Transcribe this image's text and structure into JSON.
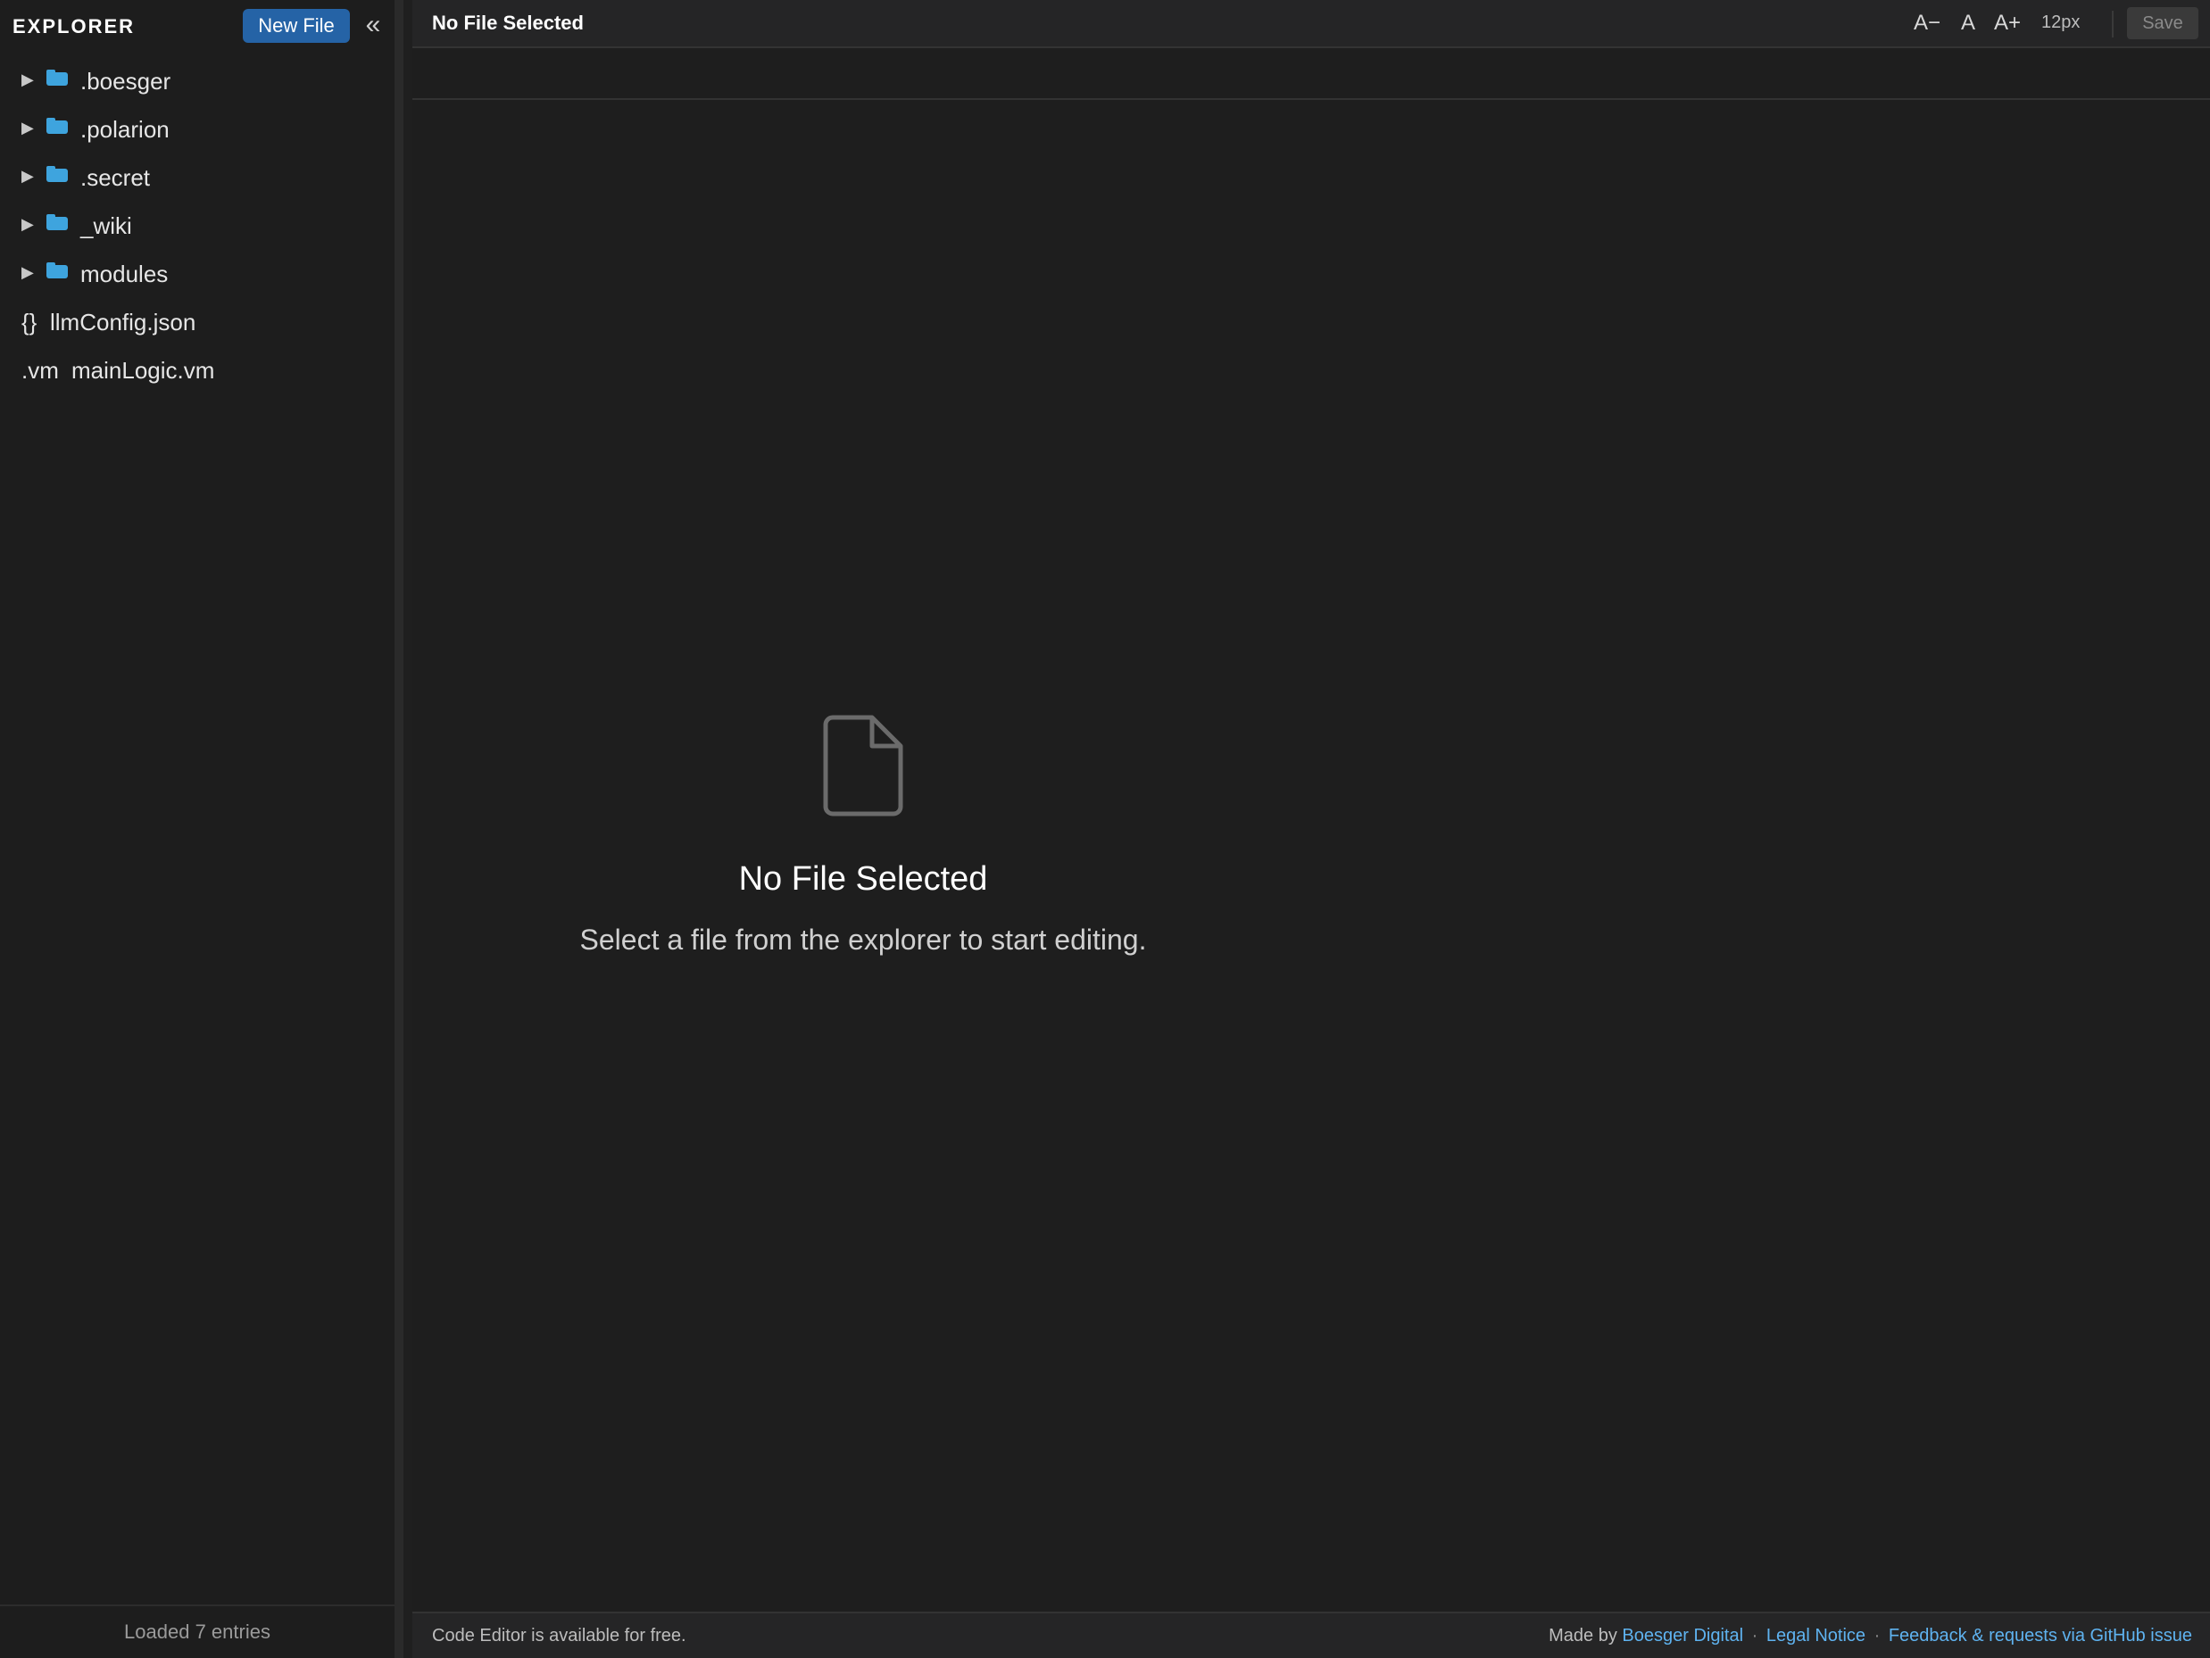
{
  "sidebar": {
    "title": "EXPLORER",
    "new_file_label": "New File",
    "collapse_glyph": "«",
    "items": [
      {
        "type": "folder",
        "label": ".boesger",
        "icon": "folder-icon"
      },
      {
        "type": "folder",
        "label": ".polarion",
        "icon": "folder-icon"
      },
      {
        "type": "folder",
        "label": ".secret",
        "icon": "folder-icon"
      },
      {
        "type": "folder",
        "label": "_wiki",
        "icon": "folder-icon"
      },
      {
        "type": "folder",
        "label": "modules",
        "icon": "folder-icon"
      },
      {
        "type": "file",
        "label": "llmConfig.json",
        "icon_text": "{}"
      },
      {
        "type": "file",
        "label": "mainLogic.vm",
        "icon_text": ".vm"
      }
    ],
    "footer": "Loaded 7 entries",
    "caret_glyph": "▶",
    "folder_color": "#3ea4de"
  },
  "topbar": {
    "title": "No File Selected",
    "font_decrease": "A−",
    "font_reset": "A",
    "font_increase": "A+",
    "font_size": "12px",
    "save_label": "Save"
  },
  "empty_state": {
    "icon": "document-icon",
    "title": "No File Selected",
    "description": "Select a file from the explorer to start editing."
  },
  "statusbar": {
    "left": "Code Editor is available for free.",
    "made_by": "Made by",
    "author": "Boesger Digital",
    "separator": "·",
    "legal": "Legal Notice",
    "feedback": "Feedback & requests via GitHub issue",
    "link_color": "#5fb3f0"
  }
}
